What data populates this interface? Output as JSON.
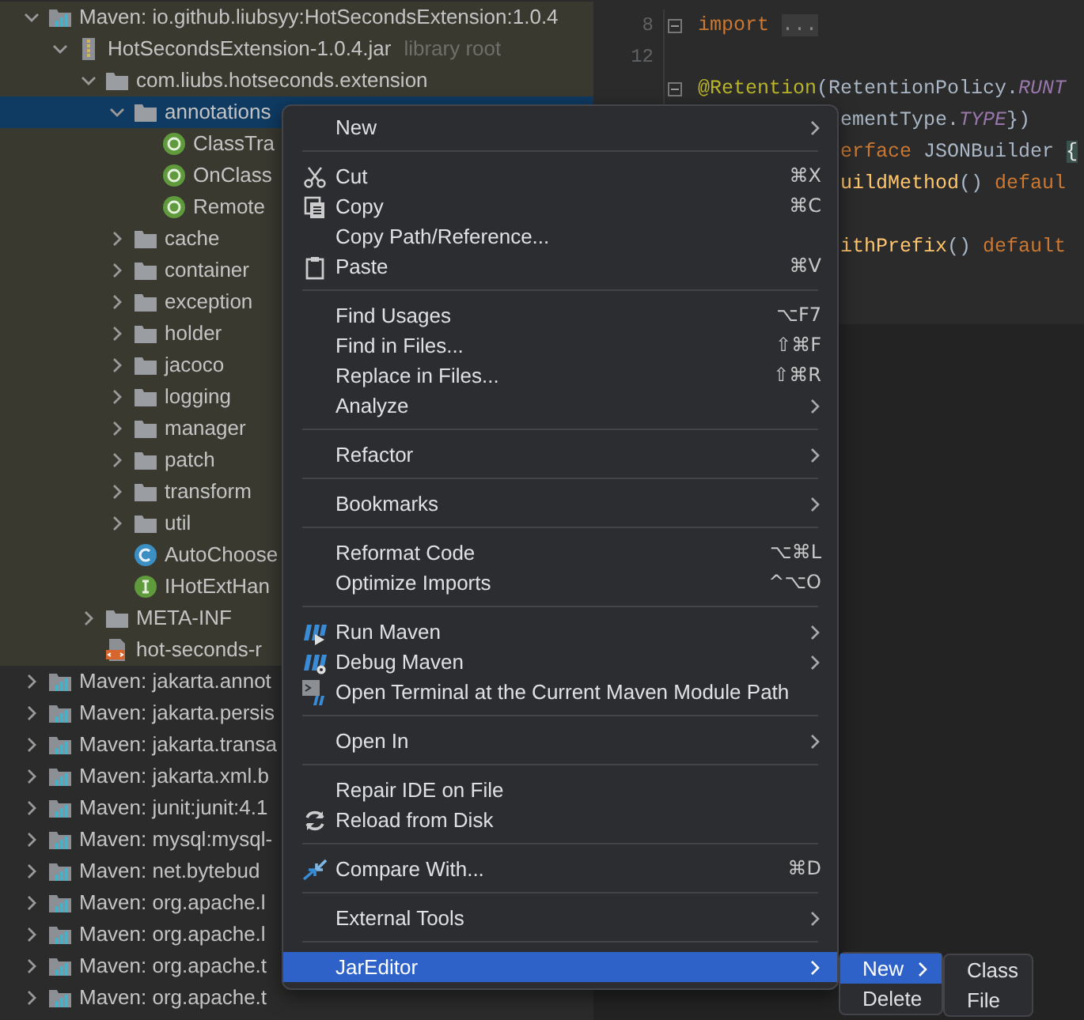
{
  "project_tree": {
    "rows": [
      {
        "label": "Maven: io.github.liubsyy:HotSecondsExtension:1.0.4",
        "kind": "maven-library",
        "expanded": true,
        "selected": false,
        "scoped": true,
        "children": [
          {
            "label": "HotSecondsExtension-1.0.4.jar",
            "suffix": "library root",
            "kind": "jar",
            "expanded": true,
            "selected": false,
            "scoped": true,
            "children": [
              {
                "label": "com.liubs.hotseconds.extension",
                "kind": "package",
                "expanded": true,
                "selected": false,
                "scoped": true,
                "children": [
                  {
                    "label": "annotations",
                    "kind": "folder",
                    "expanded": true,
                    "selected": true,
                    "scoped": true,
                    "children": [
                      {
                        "label": "ClassTra",
                        "kind": "annotation",
                        "selected": false,
                        "scoped": true
                      },
                      {
                        "label": "OnClass",
                        "kind": "annotation",
                        "selected": false,
                        "scoped": true
                      },
                      {
                        "label": "Remote",
                        "kind": "annotation",
                        "selected": false,
                        "scoped": true
                      }
                    ]
                  },
                  {
                    "label": "cache",
                    "kind": "folder",
                    "expanded": false,
                    "selected": false,
                    "scoped": true
                  },
                  {
                    "label": "container",
                    "kind": "folder",
                    "expanded": false,
                    "selected": false,
                    "scoped": true
                  },
                  {
                    "label": "exception",
                    "kind": "folder",
                    "expanded": false,
                    "selected": false,
                    "scoped": true
                  },
                  {
                    "label": "holder",
                    "kind": "folder",
                    "expanded": false,
                    "selected": false,
                    "scoped": true
                  },
                  {
                    "label": "jacoco",
                    "kind": "folder",
                    "expanded": false,
                    "selected": false,
                    "scoped": true
                  },
                  {
                    "label": "logging",
                    "kind": "folder",
                    "expanded": false,
                    "selected": false,
                    "scoped": true
                  },
                  {
                    "label": "manager",
                    "kind": "folder",
                    "expanded": false,
                    "selected": false,
                    "scoped": true
                  },
                  {
                    "label": "patch",
                    "kind": "folder",
                    "expanded": false,
                    "selected": false,
                    "scoped": true
                  },
                  {
                    "label": "transform",
                    "kind": "folder",
                    "expanded": false,
                    "selected": false,
                    "scoped": true
                  },
                  {
                    "label": "util",
                    "kind": "folder",
                    "expanded": false,
                    "selected": false,
                    "scoped": true
                  },
                  {
                    "label": "AutoChoose",
                    "kind": "class",
                    "selected": false,
                    "scoped": true
                  },
                  {
                    "label": "IHotExtHan",
                    "kind": "interface",
                    "selected": false,
                    "scoped": true
                  }
                ]
              },
              {
                "label": "META-INF",
                "kind": "folder",
                "expanded": false,
                "selected": false,
                "scoped": true
              },
              {
                "label": "hot-seconds-r",
                "kind": "xml",
                "selected": false,
                "scoped": true
              }
            ]
          }
        ]
      },
      {
        "label": "Maven: jakarta.annot",
        "kind": "maven-library",
        "expanded": false,
        "selected": false,
        "scoped": false
      },
      {
        "label": "Maven: jakarta.persis",
        "kind": "maven-library",
        "expanded": false,
        "selected": false,
        "scoped": false
      },
      {
        "label": "Maven: jakarta.transa",
        "kind": "maven-library",
        "expanded": false,
        "selected": false,
        "scoped": false
      },
      {
        "label": "Maven: jakarta.xml.b",
        "kind": "maven-library",
        "expanded": false,
        "selected": false,
        "scoped": false
      },
      {
        "label": "Maven: junit:junit:4.1",
        "kind": "maven-library",
        "expanded": false,
        "selected": false,
        "scoped": false
      },
      {
        "label": "Maven: mysql:mysql-",
        "kind": "maven-library",
        "expanded": false,
        "selected": false,
        "scoped": false
      },
      {
        "label": "Maven: net.bytebud",
        "kind": "maven-library",
        "expanded": false,
        "selected": false,
        "scoped": false
      },
      {
        "label": "Maven: org.apache.l",
        "kind": "maven-library",
        "expanded": false,
        "selected": false,
        "scoped": false
      },
      {
        "label": "Maven: org.apache.l",
        "kind": "maven-library",
        "expanded": false,
        "selected": false,
        "scoped": false
      },
      {
        "label": "Maven: org.apache.t",
        "kind": "maven-library",
        "expanded": false,
        "selected": false,
        "scoped": false
      },
      {
        "label": "Maven: org.apache.t",
        "kind": "maven-library",
        "expanded": false,
        "selected": false,
        "scoped": false
      }
    ]
  },
  "editor": {
    "lines": [
      {
        "number": "8",
        "foldable": true,
        "cut": false,
        "segments": [
          {
            "kind": "keyword",
            "text": "import"
          },
          {
            "kind": "folded",
            "text": "..."
          }
        ]
      },
      {
        "number": "12"
      },
      {
        "foldable": true,
        "cut": false,
        "segments": [
          {
            "kind": "annotation",
            "text": "@Retention"
          },
          {
            "kind": "plain",
            "text": "(RetentionPolicy."
          },
          {
            "kind": "constant",
            "text": "RUNT"
          }
        ]
      },
      {
        "cut": true,
        "segments": [
          {
            "kind": "plain",
            "text": "ementType."
          },
          {
            "kind": "constant",
            "text": "TYPE"
          },
          {
            "kind": "plain",
            "text": "})"
          }
        ]
      },
      {
        "cut": true,
        "segments": [
          {
            "kind": "keyword",
            "text": "erface"
          },
          {
            "kind": "plain",
            "text": " JSONBuilder "
          },
          {
            "kind": "brace",
            "text": "{"
          }
        ]
      },
      {
        "cut": true,
        "segments": [
          {
            "kind": "method",
            "text": "uildMethod"
          },
          {
            "kind": "plain",
            "text": "() "
          },
          {
            "kind": "keyword",
            "text": "defaul"
          }
        ]
      },
      {
        "cut": true,
        "gap_before": true,
        "segments": [
          {
            "kind": "method",
            "text": "ithPrefix"
          },
          {
            "kind": "plain",
            "text": "() "
          },
          {
            "kind": "keyword",
            "text": "default"
          }
        ]
      }
    ]
  },
  "context_menu": {
    "items": [
      {
        "kind": "item",
        "label": "New",
        "submenu": true,
        "selected": false
      },
      {
        "kind": "separator"
      },
      {
        "kind": "item",
        "label": "Cut",
        "shortcut": "⌘X",
        "submenu": false,
        "selected": false
      },
      {
        "kind": "item",
        "label": "Copy",
        "shortcut": "⌘C",
        "submenu": false,
        "selected": false
      },
      {
        "kind": "item",
        "label": "Copy Path/Reference...",
        "submenu": false,
        "selected": false
      },
      {
        "kind": "item",
        "label": "Paste",
        "shortcut": "⌘V",
        "submenu": false,
        "selected": false
      },
      {
        "kind": "separator"
      },
      {
        "kind": "item",
        "label": "Find Usages",
        "shortcut": "⌥F7",
        "submenu": false,
        "selected": false
      },
      {
        "kind": "item",
        "label": "Find in Files...",
        "shortcut": "⇧⌘F",
        "submenu": false,
        "selected": false
      },
      {
        "kind": "item",
        "label": "Replace in Files...",
        "shortcut": "⇧⌘R",
        "submenu": false,
        "selected": false
      },
      {
        "kind": "item",
        "label": "Analyze",
        "submenu": true,
        "selected": false
      },
      {
        "kind": "separator"
      },
      {
        "kind": "item",
        "label": "Refactor",
        "submenu": true,
        "selected": false
      },
      {
        "kind": "separator"
      },
      {
        "kind": "item",
        "label": "Bookmarks",
        "submenu": true,
        "selected": false
      },
      {
        "kind": "separator"
      },
      {
        "kind": "item",
        "label": "Reformat Code",
        "shortcut": "⌥⌘L",
        "submenu": false,
        "selected": false
      },
      {
        "kind": "item",
        "label": "Optimize Imports",
        "shortcut": "^⌥O",
        "submenu": false,
        "selected": false
      },
      {
        "kind": "separator"
      },
      {
        "kind": "item",
        "label": "Run Maven",
        "submenu": true,
        "selected": false
      },
      {
        "kind": "item",
        "label": "Debug Maven",
        "submenu": true,
        "selected": false
      },
      {
        "kind": "item",
        "label": "Open Terminal at the Current Maven Module Path",
        "submenu": false,
        "selected": false
      },
      {
        "kind": "separator"
      },
      {
        "kind": "item",
        "label": "Open In",
        "submenu": true,
        "selected": false
      },
      {
        "kind": "separator"
      },
      {
        "kind": "item",
        "label": "Repair IDE on File",
        "submenu": false,
        "selected": false
      },
      {
        "kind": "item",
        "label": "Reload from Disk",
        "submenu": false,
        "selected": false
      },
      {
        "kind": "separator"
      },
      {
        "kind": "item",
        "label": "Compare With...",
        "shortcut": "⌘D",
        "submenu": false,
        "selected": false
      },
      {
        "kind": "separator"
      },
      {
        "kind": "item",
        "label": "External Tools",
        "submenu": true,
        "selected": false
      },
      {
        "kind": "separator"
      },
      {
        "kind": "item",
        "label": "JarEditor",
        "submenu": true,
        "selected": true
      }
    ]
  },
  "submenus": [
    {
      "items": [
        {
          "kind": "item",
          "label": "New",
          "submenu": true,
          "selected": true
        },
        {
          "kind": "item",
          "label": "Delete",
          "submenu": false,
          "selected": false
        }
      ]
    },
    {
      "items": [
        {
          "kind": "item",
          "label": "Class",
          "submenu": false,
          "selected": false
        },
        {
          "kind": "item",
          "label": "File",
          "submenu": false,
          "selected": false
        }
      ]
    }
  ]
}
